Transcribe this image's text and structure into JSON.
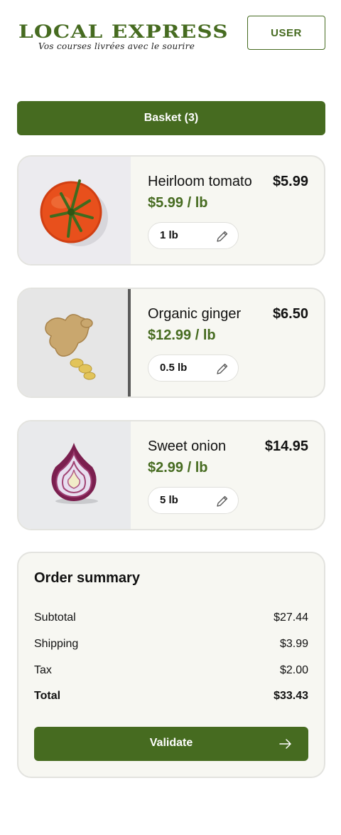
{
  "header": {
    "logo_title": "LOCAL EXPRESS",
    "logo_tagline": "Vos courses livrées avec le sourire",
    "user_label": "USER"
  },
  "basket": {
    "label": "Basket (3)"
  },
  "items": [
    {
      "name": "Heirloom tomato",
      "price": "$5.99",
      "unit_price": "$5.99 / lb",
      "quantity": "1 lb",
      "image": "tomato-photo"
    },
    {
      "name": "Organic ginger",
      "price": "$6.50",
      "unit_price": "$12.99 / lb",
      "quantity": "0.5 lb",
      "image": "ginger-photo"
    },
    {
      "name": "Sweet onion",
      "price": "$14.95",
      "unit_price": "$2.99 / lb",
      "quantity": "5 lb",
      "image": "onion-photo"
    }
  ],
  "summary": {
    "title": "Order summary",
    "subtotal_label": "Subtotal",
    "subtotal": "$27.44",
    "shipping_label": "Shipping",
    "shipping": "$3.99",
    "tax_label": "Tax",
    "tax": "$2.00",
    "total_label": "Total",
    "total": "$33.43",
    "validate_label": "Validate"
  },
  "icons": {
    "edit": "pencil-icon",
    "next": "arrow-right-icon"
  },
  "colors": {
    "brand": "#466b20",
    "card_bg": "#f7f7f2",
    "card_border": "#e3e3df"
  }
}
